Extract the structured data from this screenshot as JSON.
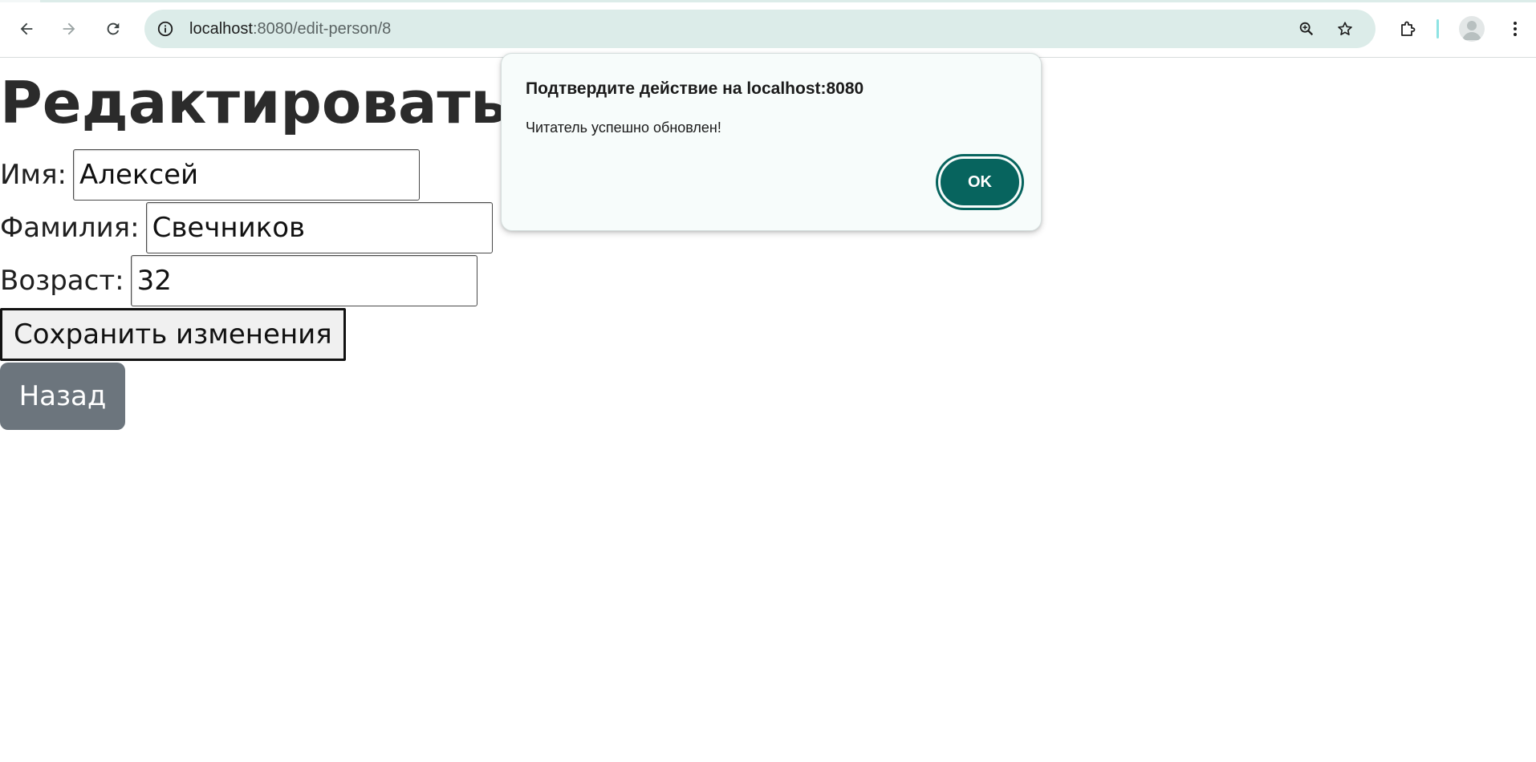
{
  "browser": {
    "url_host": "localhost",
    "url_path": ":8080/edit-person/8",
    "icons": {
      "back": "arrow-left-icon",
      "forward": "arrow-right-icon",
      "reload": "reload-icon",
      "site_info": "info-icon",
      "zoom": "zoom-icon",
      "bookmark": "star-icon",
      "extensions": "puzzle-icon",
      "profile": "avatar-icon",
      "menu": "kebab-menu-icon"
    },
    "colors": {
      "omnibox": "#dcece9",
      "divider": "#8ee3e3"
    }
  },
  "page": {
    "heading": "Редактировать читателя",
    "fields": [
      {
        "label": "Имя:",
        "value": "Алексей"
      },
      {
        "label": "Фамилия:",
        "value": "Свечников"
      },
      {
        "label": "Возраст:",
        "value": "32"
      }
    ],
    "save_label": "Сохранить изменения",
    "back_label": "Назад",
    "colors": {
      "back_button": "#6c757d"
    }
  },
  "dialog": {
    "title": "Подтвердите действие на localhost:8080",
    "message": "Читатель успешно обновлен!",
    "ok_label": "OK",
    "colors": {
      "ok_button": "#07645e",
      "background": "#f7fcfb"
    }
  }
}
